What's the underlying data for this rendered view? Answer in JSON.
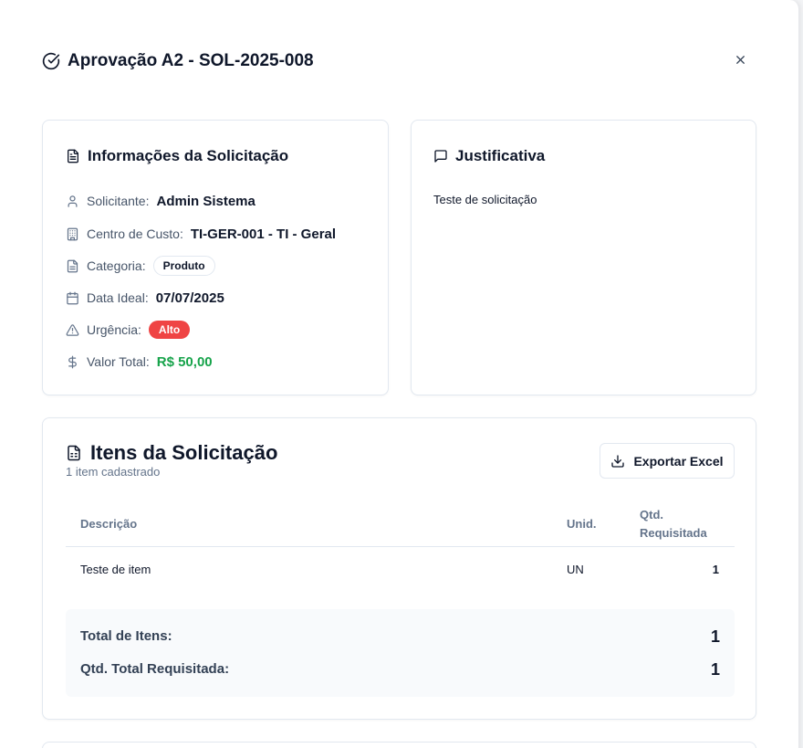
{
  "modal": {
    "title": "Aprovação A2 - SOL-2025-008",
    "close_icon": "close-icon"
  },
  "info": {
    "title": "Informações da Solicitação",
    "requester_label": "Solicitante:",
    "requester_value": "Admin Sistema",
    "cost_center_label": "Centro de Custo:",
    "cost_center_value": "TI-GER-001 - TI - Geral",
    "category_label": "Categoria:",
    "category_value": "Produto",
    "date_label": "Data Ideal:",
    "date_value": "07/07/2025",
    "urgency_label": "Urgência:",
    "urgency_value": "Alto",
    "total_label": "Valor Total:",
    "total_value": "R$ 50,00"
  },
  "justification": {
    "title": "Justificativa",
    "text": "Teste de solicitação"
  },
  "items": {
    "title": "Itens da Solicitação",
    "subtitle": "1 item cadastrado",
    "export_label": "Exportar Excel",
    "columns": [
      "Descrição",
      "Unid.",
      "Qtd.",
      "Requisitada"
    ],
    "rows": [
      {
        "description": "Teste de item",
        "unit": "UN",
        "qty": "1"
      }
    ],
    "summary": {
      "total_items_label": "Total de Itens:",
      "total_items_value": "1",
      "total_qty_label": "Qtd. Total Requisitada:",
      "total_qty_value": "1"
    }
  },
  "colors": {
    "accent_green": "#16a34a",
    "badge_red": "#ef4444",
    "muted_text": "#64748b"
  }
}
